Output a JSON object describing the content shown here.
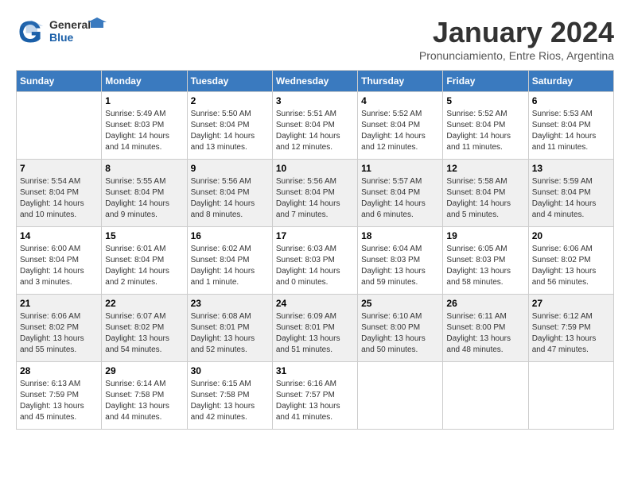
{
  "header": {
    "logo": {
      "general": "General",
      "blue": "Blue"
    },
    "title": "January 2024",
    "location": "Pronunciamiento, Entre Rios, Argentina"
  },
  "weekdays": [
    "Sunday",
    "Monday",
    "Tuesday",
    "Wednesday",
    "Thursday",
    "Friday",
    "Saturday"
  ],
  "weeks": [
    [
      {
        "day": "",
        "info": ""
      },
      {
        "day": "1",
        "info": "Sunrise: 5:49 AM\nSunset: 8:03 PM\nDaylight: 14 hours\nand 14 minutes."
      },
      {
        "day": "2",
        "info": "Sunrise: 5:50 AM\nSunset: 8:04 PM\nDaylight: 14 hours\nand 13 minutes."
      },
      {
        "day": "3",
        "info": "Sunrise: 5:51 AM\nSunset: 8:04 PM\nDaylight: 14 hours\nand 12 minutes."
      },
      {
        "day": "4",
        "info": "Sunrise: 5:52 AM\nSunset: 8:04 PM\nDaylight: 14 hours\nand 12 minutes."
      },
      {
        "day": "5",
        "info": "Sunrise: 5:52 AM\nSunset: 8:04 PM\nDaylight: 14 hours\nand 11 minutes."
      },
      {
        "day": "6",
        "info": "Sunrise: 5:53 AM\nSunset: 8:04 PM\nDaylight: 14 hours\nand 11 minutes."
      }
    ],
    [
      {
        "day": "7",
        "info": "Sunrise: 5:54 AM\nSunset: 8:04 PM\nDaylight: 14 hours\nand 10 minutes."
      },
      {
        "day": "8",
        "info": "Sunrise: 5:55 AM\nSunset: 8:04 PM\nDaylight: 14 hours\nand 9 minutes."
      },
      {
        "day": "9",
        "info": "Sunrise: 5:56 AM\nSunset: 8:04 PM\nDaylight: 14 hours\nand 8 minutes."
      },
      {
        "day": "10",
        "info": "Sunrise: 5:56 AM\nSunset: 8:04 PM\nDaylight: 14 hours\nand 7 minutes."
      },
      {
        "day": "11",
        "info": "Sunrise: 5:57 AM\nSunset: 8:04 PM\nDaylight: 14 hours\nand 6 minutes."
      },
      {
        "day": "12",
        "info": "Sunrise: 5:58 AM\nSunset: 8:04 PM\nDaylight: 14 hours\nand 5 minutes."
      },
      {
        "day": "13",
        "info": "Sunrise: 5:59 AM\nSunset: 8:04 PM\nDaylight: 14 hours\nand 4 minutes."
      }
    ],
    [
      {
        "day": "14",
        "info": "Sunrise: 6:00 AM\nSunset: 8:04 PM\nDaylight: 14 hours\nand 3 minutes."
      },
      {
        "day": "15",
        "info": "Sunrise: 6:01 AM\nSunset: 8:04 PM\nDaylight: 14 hours\nand 2 minutes."
      },
      {
        "day": "16",
        "info": "Sunrise: 6:02 AM\nSunset: 8:04 PM\nDaylight: 14 hours\nand 1 minute."
      },
      {
        "day": "17",
        "info": "Sunrise: 6:03 AM\nSunset: 8:03 PM\nDaylight: 14 hours\nand 0 minutes."
      },
      {
        "day": "18",
        "info": "Sunrise: 6:04 AM\nSunset: 8:03 PM\nDaylight: 13 hours\nand 59 minutes."
      },
      {
        "day": "19",
        "info": "Sunrise: 6:05 AM\nSunset: 8:03 PM\nDaylight: 13 hours\nand 58 minutes."
      },
      {
        "day": "20",
        "info": "Sunrise: 6:06 AM\nSunset: 8:02 PM\nDaylight: 13 hours\nand 56 minutes."
      }
    ],
    [
      {
        "day": "21",
        "info": "Sunrise: 6:06 AM\nSunset: 8:02 PM\nDaylight: 13 hours\nand 55 minutes."
      },
      {
        "day": "22",
        "info": "Sunrise: 6:07 AM\nSunset: 8:02 PM\nDaylight: 13 hours\nand 54 minutes."
      },
      {
        "day": "23",
        "info": "Sunrise: 6:08 AM\nSunset: 8:01 PM\nDaylight: 13 hours\nand 52 minutes."
      },
      {
        "day": "24",
        "info": "Sunrise: 6:09 AM\nSunset: 8:01 PM\nDaylight: 13 hours\nand 51 minutes."
      },
      {
        "day": "25",
        "info": "Sunrise: 6:10 AM\nSunset: 8:00 PM\nDaylight: 13 hours\nand 50 minutes."
      },
      {
        "day": "26",
        "info": "Sunrise: 6:11 AM\nSunset: 8:00 PM\nDaylight: 13 hours\nand 48 minutes."
      },
      {
        "day": "27",
        "info": "Sunrise: 6:12 AM\nSunset: 7:59 PM\nDaylight: 13 hours\nand 47 minutes."
      }
    ],
    [
      {
        "day": "28",
        "info": "Sunrise: 6:13 AM\nSunset: 7:59 PM\nDaylight: 13 hours\nand 45 minutes."
      },
      {
        "day": "29",
        "info": "Sunrise: 6:14 AM\nSunset: 7:58 PM\nDaylight: 13 hours\nand 44 minutes."
      },
      {
        "day": "30",
        "info": "Sunrise: 6:15 AM\nSunset: 7:58 PM\nDaylight: 13 hours\nand 42 minutes."
      },
      {
        "day": "31",
        "info": "Sunrise: 6:16 AM\nSunset: 7:57 PM\nDaylight: 13 hours\nand 41 minutes."
      },
      {
        "day": "",
        "info": ""
      },
      {
        "day": "",
        "info": ""
      },
      {
        "day": "",
        "info": ""
      }
    ]
  ]
}
